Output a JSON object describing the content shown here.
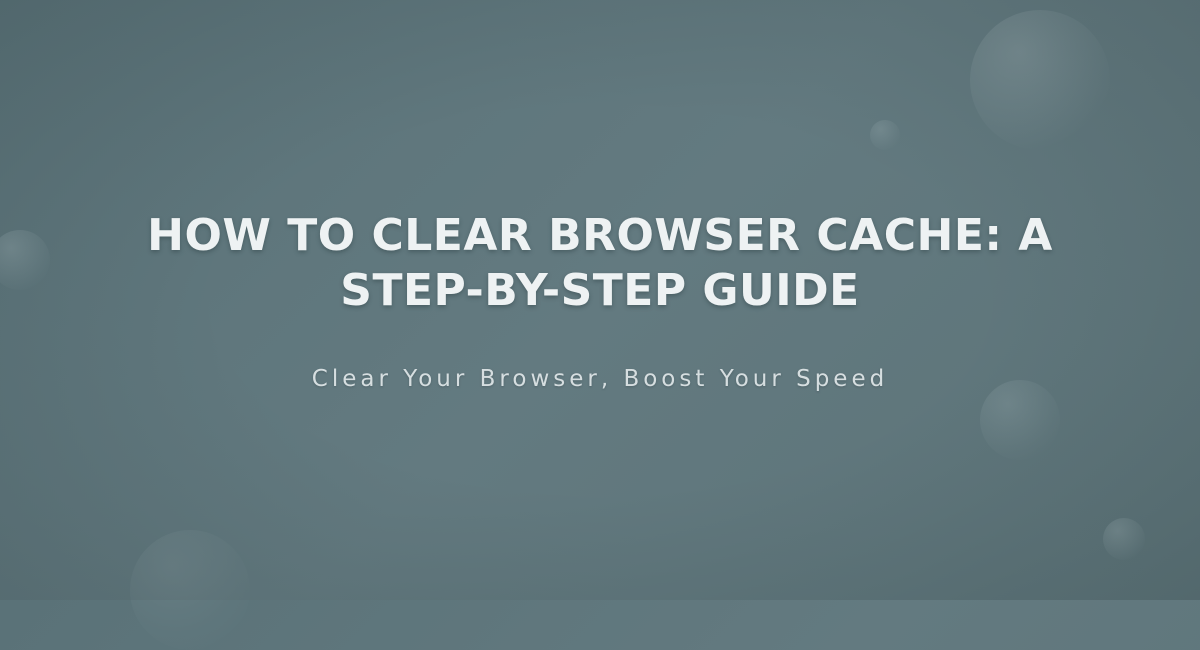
{
  "hero": {
    "title": "HOW TO CLEAR BROWSER CACHE: A STEP-BY-STEP GUIDE",
    "subtitle": "Clear Your Browser, Boost Your Speed"
  }
}
